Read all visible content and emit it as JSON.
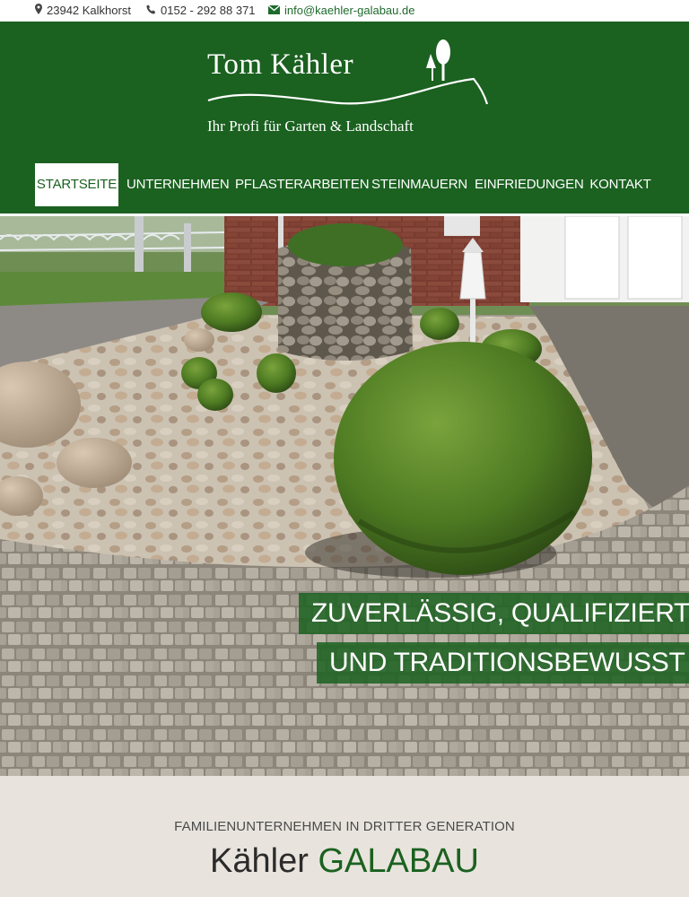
{
  "topbar": {
    "address": "23942 Kalkhorst",
    "phone": "0152 - 292 88 371",
    "email": "info@kaehler-galabau.de",
    "icons": [
      "map-marker-icon",
      "phone-icon",
      "envelope-icon"
    ]
  },
  "brand": {
    "name": "Tom Kähler",
    "tagline": "Ihr Profi für Garten & Landschaft",
    "header_color": "#1b6120"
  },
  "nav": {
    "items": [
      {
        "label": "STARTSEITE",
        "active": true
      },
      {
        "label": "UNTERNEHMEN"
      },
      {
        "label": "PFLASTERARBEITEN"
      },
      {
        "label": "STEINMAUERN"
      },
      {
        "label": "EINFRIEDUNGEN"
      },
      {
        "label": "KONTAKT"
      }
    ]
  },
  "hero": {
    "slogan_line1": "ZUVERLÄSSIG, QUALIFIZIERT",
    "slogan_line2": "UND TRADITIONSBEWUSST"
  },
  "intro": {
    "kicker": "FAMILIENUNTERNEHMEN IN DRITTER GENERATION",
    "title_main": "Kähler",
    "title_accent": "GALABAU"
  }
}
